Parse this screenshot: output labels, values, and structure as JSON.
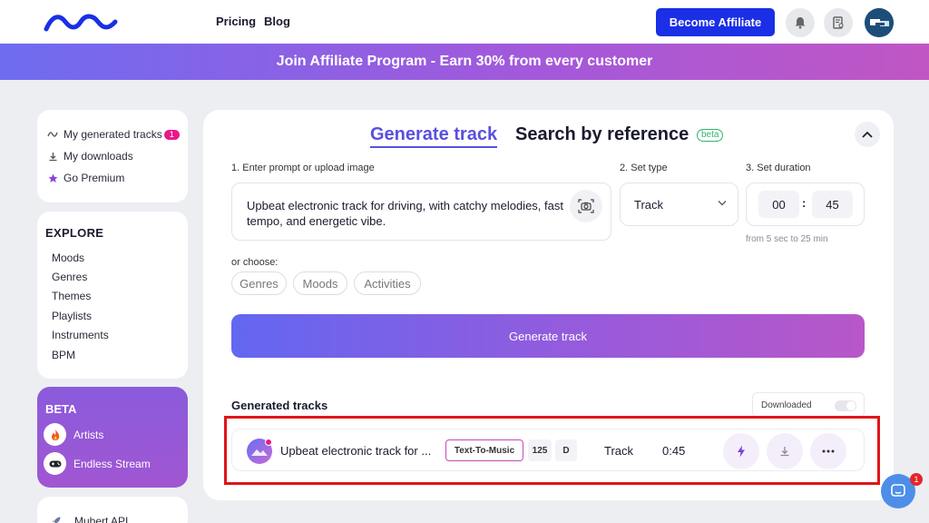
{
  "header": {
    "nav": [
      "Pricing",
      "Blog"
    ],
    "affiliate_button": "Become Affiliate"
  },
  "banner": {
    "text": "Join Affiliate Program - Earn 30% from every customer"
  },
  "sidebar": {
    "top_items": [
      {
        "label": "My generated tracks",
        "icon": "wave-icon",
        "badge": "1"
      },
      {
        "label": "My downloads",
        "icon": "download-icon"
      },
      {
        "label": "Go Premium",
        "icon": "star-icon"
      }
    ],
    "explore": {
      "title": "EXPLORE",
      "items": [
        "Moods",
        "Genres",
        "Themes",
        "Playlists",
        "Instruments",
        "BPM"
      ]
    },
    "beta": {
      "title": "BETA",
      "items": [
        {
          "label": "Artists",
          "icon": "fire-icon"
        },
        {
          "label": "Endless Stream",
          "icon": "gamepad-icon"
        }
      ]
    },
    "api_item": "Mubert API"
  },
  "main": {
    "tabs": {
      "generate": "Generate track",
      "search": "Search by reference",
      "beta_tag": "beta"
    },
    "prompt_label": "1. Enter prompt or upload image",
    "prompt_text": "Upbeat electronic track for driving, with catchy melodies, fast tempo, and energetic vibe.",
    "type_label": "2. Set type",
    "type_value": "Track",
    "duration_label": "3. Set duration",
    "duration_minutes": "00",
    "duration_seconds": "45",
    "duration_hint": "from 5 sec to 25 min",
    "or_choose": "or choose:",
    "chips": [
      "Genres",
      "Moods",
      "Activities"
    ],
    "generate_button": "Generate track",
    "generated_title": "Generated tracks",
    "downloaded_toggle": "Downloaded"
  },
  "track": {
    "name": "Upbeat electronic track for ...",
    "source": "Text-To-Music",
    "bpm": "125",
    "key": "D",
    "type": "Track",
    "duration": "0:45"
  },
  "chat": {
    "badge": "1"
  },
  "colors": {
    "brand_blue": "#1a2fe6",
    "accent_purple": "#5a4fe0",
    "highlight_red": "#e0141b",
    "badge_pink": "#e8198b"
  }
}
